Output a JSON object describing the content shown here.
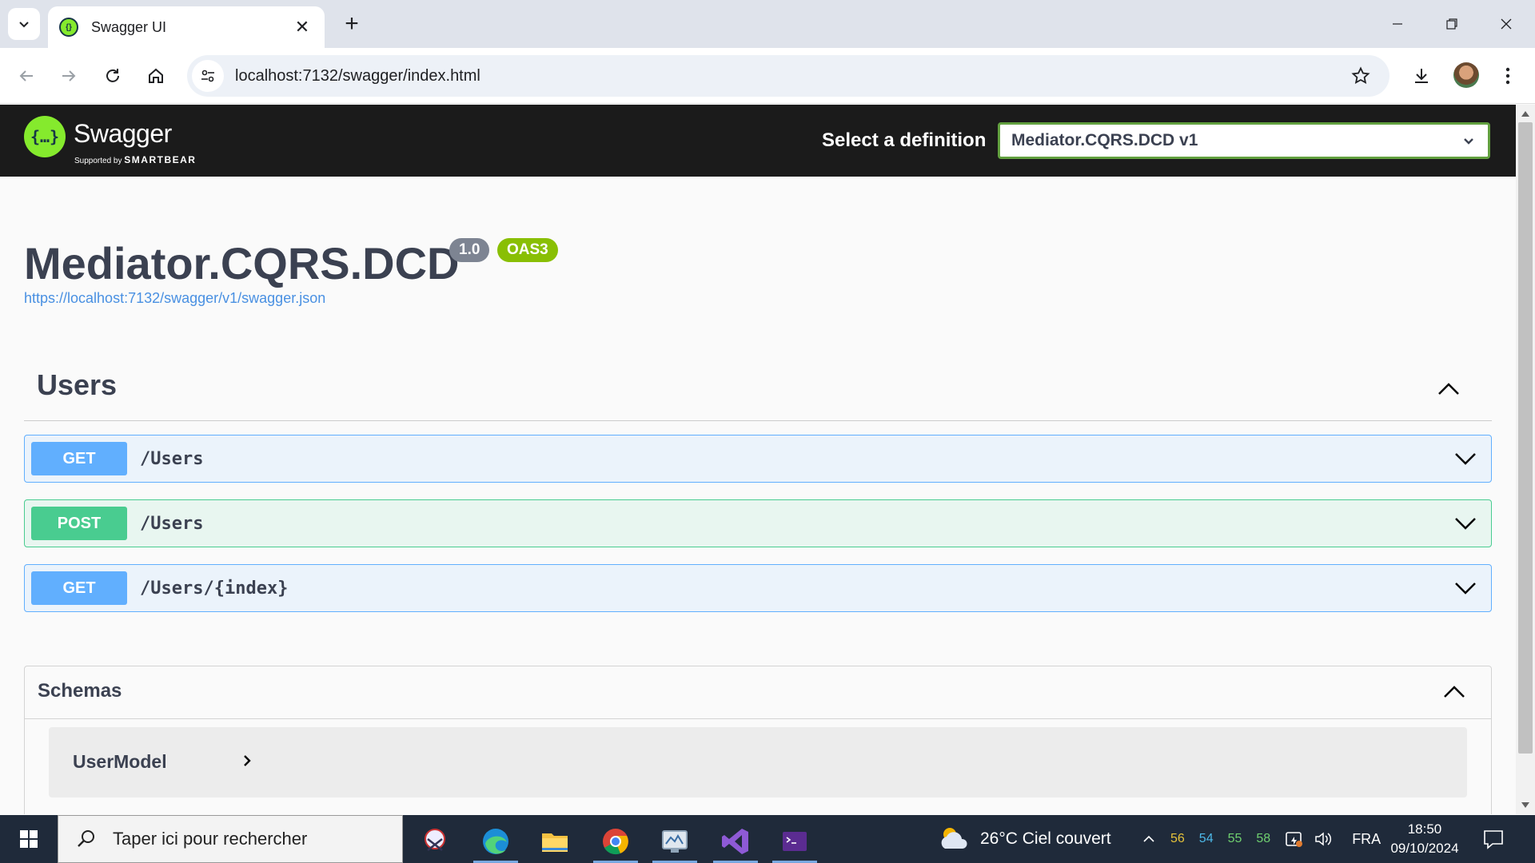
{
  "browser": {
    "tab_title": "Swagger UI",
    "new_tab_symbol": "+",
    "close_symbol": "✕",
    "url": "localhost:7132/swagger/index.html"
  },
  "swagger": {
    "brand": "Swagger",
    "supported_by": "Supported by",
    "smartbear": "SMARTBEAR",
    "definition_label": "Select a definition",
    "definition_value": "Mediator.CQRS.DCD v1",
    "api_title": "Mediator.CQRS.DCD",
    "version_badge": "1.0",
    "oas_badge": "OAS3",
    "spec_link": "https://localhost:7132/swagger/v1/swagger.json",
    "tag": "Users",
    "operations": [
      {
        "method": "GET",
        "path": "/Users"
      },
      {
        "method": "POST",
        "path": "/Users"
      },
      {
        "method": "GET",
        "path": "/Users/{index}"
      }
    ],
    "schemas_title": "Schemas",
    "models": [
      "UserModel"
    ]
  },
  "taskbar": {
    "search_placeholder": "Taper ici pour rechercher",
    "weather": "26°C  Ciel couvert",
    "tray_numbers": [
      "56",
      "54",
      "55",
      "58"
    ],
    "language": "FRA",
    "time": "18:50",
    "date": "09/10/2024"
  },
  "colors": {
    "get": "#61affe",
    "post": "#49cc90",
    "swagger_green": "#85ea2d",
    "header": "#1b1b1b"
  }
}
